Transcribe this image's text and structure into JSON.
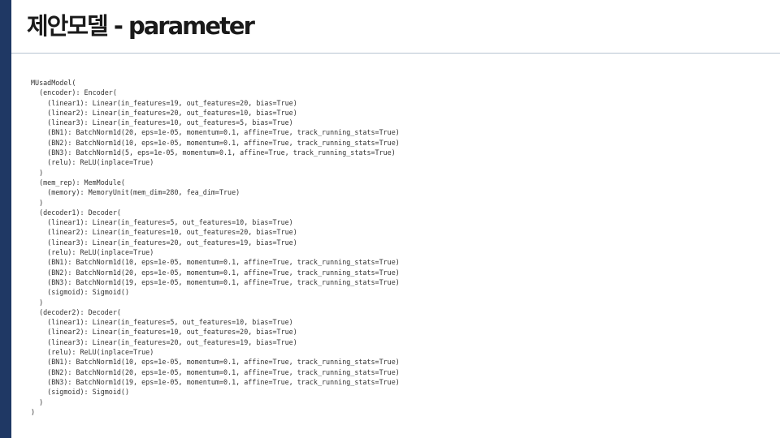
{
  "slide": {
    "title": "제안모델 - parameter",
    "accent_color": "#1f3864",
    "divider_color": "#b8c4d1"
  },
  "code": {
    "lines": [
      "MUsadModel(",
      "  (encoder): Encoder(",
      "    (linear1): Linear(in_features=19, out_features=20, bias=True)",
      "    (linear2): Linear(in_features=20, out_features=10, bias=True)",
      "    (linear3): Linear(in_features=10, out_features=5, bias=True)",
      "    (BN1): BatchNorm1d(20, eps=1e-05, momentum=0.1, affine=True, track_running_stats=True)",
      "    (BN2): BatchNorm1d(10, eps=1e-05, momentum=0.1, affine=True, track_running_stats=True)",
      "    (BN3): BatchNorm1d(5, eps=1e-05, momentum=0.1, affine=True, track_running_stats=True)",
      "    (relu): ReLU(inplace=True)",
      "  )",
      "  (mem_rep): MemModule(",
      "    (memory): MemoryUnit(mem_dim=280, fea_dim=True)",
      "  )",
      "  (decoder1): Decoder(",
      "    (linear1): Linear(in_features=5, out_features=10, bias=True)",
      "    (linear2): Linear(in_features=10, out_features=20, bias=True)",
      "    (linear3): Linear(in_features=20, out_features=19, bias=True)",
      "    (relu): ReLU(inplace=True)",
      "    (BN1): BatchNorm1d(10, eps=1e-05, momentum=0.1, affine=True, track_running_stats=True)",
      "    (BN2): BatchNorm1d(20, eps=1e-05, momentum=0.1, affine=True, track_running_stats=True)",
      "    (BN3): BatchNorm1d(19, eps=1e-05, momentum=0.1, affine=True, track_running_stats=True)",
      "    (sigmoid): Sigmoid()",
      "  )",
      "  (decoder2): Decoder(",
      "    (linear1): Linear(in_features=5, out_features=10, bias=True)",
      "    (linear2): Linear(in_features=10, out_features=20, bias=True)",
      "    (linear3): Linear(in_features=20, out_features=19, bias=True)",
      "    (relu): ReLU(inplace=True)",
      "    (BN1): BatchNorm1d(10, eps=1e-05, momentum=0.1, affine=True, track_running_stats=True)",
      "    (BN2): BatchNorm1d(20, eps=1e-05, momentum=0.1, affine=True, track_running_stats=True)",
      "    (BN3): BatchNorm1d(19, eps=1e-05, momentum=0.1, affine=True, track_running_stats=True)",
      "    (sigmoid): Sigmoid()",
      "  )",
      ")"
    ]
  }
}
